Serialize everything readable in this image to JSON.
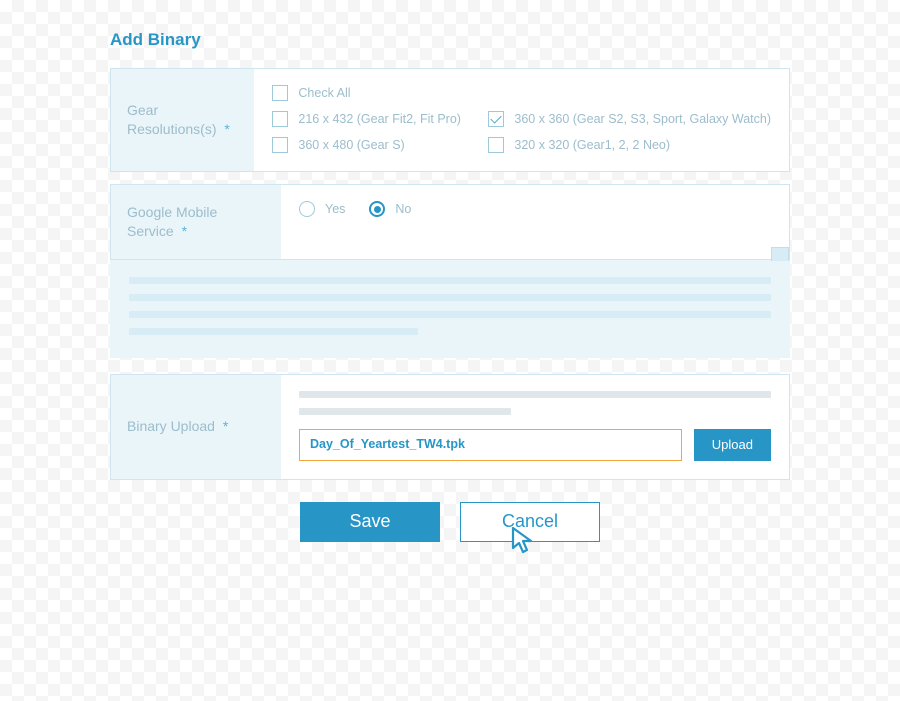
{
  "title": "Add Binary",
  "resolutions": {
    "label": "Gear Resolutions(s)",
    "required_mark": "*",
    "check_all": "Check All",
    "items": [
      {
        "label": "216 x 432 (Gear Fit2, Fit Pro)",
        "checked": false
      },
      {
        "label": "360 x 360 (Gear S2, S3, Sport, Galaxy Watch)",
        "checked": true
      },
      {
        "label": "360 x 480 (Gear S)",
        "checked": false
      },
      {
        "label": "320 x 320 (Gear1, 2, 2 Neo)",
        "checked": false
      }
    ]
  },
  "gms": {
    "label": "Google Mobile Service",
    "required_mark": "*",
    "yes": "Yes",
    "no": "No",
    "selected": "No"
  },
  "binary": {
    "label": "Binary Upload",
    "required_mark": "*",
    "filename": "Day_Of_Yeartest_TW4.tpk",
    "upload_btn": "Upload"
  },
  "footer": {
    "save": "Save",
    "cancel": "Cancel"
  }
}
